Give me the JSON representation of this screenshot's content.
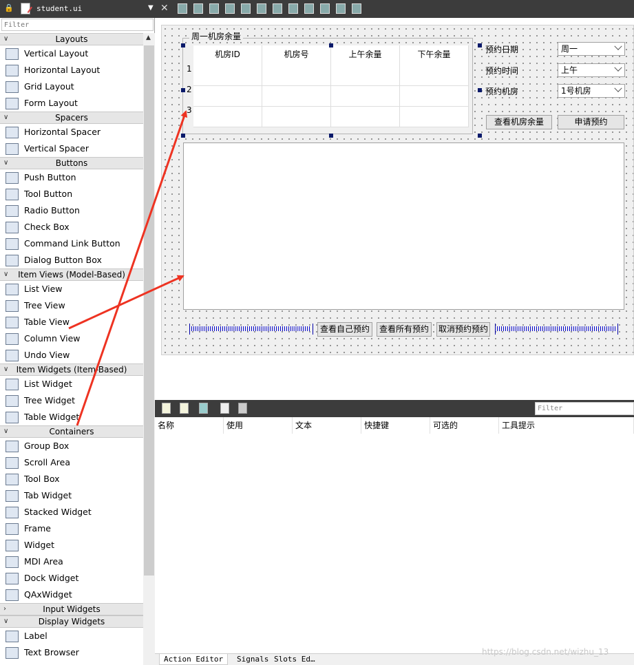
{
  "file_tab": {
    "name": "student.ui"
  },
  "widget_box": {
    "filter_placeholder": "Filter",
    "categories": [
      {
        "label": "Layouts",
        "expanded": true,
        "items": [
          {
            "label": "Vertical Layout",
            "icon": "vertical-layout-icon"
          },
          {
            "label": "Horizontal Layout",
            "icon": "horizontal-layout-icon"
          },
          {
            "label": "Grid Layout",
            "icon": "grid-layout-icon"
          },
          {
            "label": "Form Layout",
            "icon": "form-layout-icon"
          }
        ]
      },
      {
        "label": "Spacers",
        "expanded": true,
        "items": [
          {
            "label": "Horizontal Spacer",
            "icon": "horizontal-spacer-icon"
          },
          {
            "label": "Vertical Spacer",
            "icon": "vertical-spacer-icon"
          }
        ]
      },
      {
        "label": "Buttons",
        "expanded": true,
        "items": [
          {
            "label": "Push Button",
            "icon": "push-button-icon"
          },
          {
            "label": "Tool Button",
            "icon": "tool-button-icon"
          },
          {
            "label": "Radio Button",
            "icon": "radio-button-icon"
          },
          {
            "label": "Check Box",
            "icon": "check-box-icon"
          },
          {
            "label": "Command Link Button",
            "icon": "command-link-icon"
          },
          {
            "label": "Dialog Button Box",
            "icon": "dialog-button-box-icon"
          }
        ]
      },
      {
        "label": "Item Views (Model-Based)",
        "expanded": true,
        "items": [
          {
            "label": "List View",
            "icon": "list-view-icon"
          },
          {
            "label": "Tree View",
            "icon": "tree-view-icon"
          },
          {
            "label": "Table View",
            "icon": "table-view-icon"
          },
          {
            "label": "Column View",
            "icon": "column-view-icon"
          },
          {
            "label": "Undo View",
            "icon": "undo-view-icon"
          }
        ]
      },
      {
        "label": "Item Widgets (Item-Based)",
        "expanded": true,
        "items": [
          {
            "label": "List Widget",
            "icon": "list-widget-icon"
          },
          {
            "label": "Tree Widget",
            "icon": "tree-widget-icon"
          },
          {
            "label": "Table Widget",
            "icon": "table-widget-icon"
          }
        ]
      },
      {
        "label": "Containers",
        "expanded": true,
        "items": [
          {
            "label": "Group Box",
            "icon": "group-box-icon"
          },
          {
            "label": "Scroll Area",
            "icon": "scroll-area-icon"
          },
          {
            "label": "Tool Box",
            "icon": "tool-box-icon"
          },
          {
            "label": "Tab Widget",
            "icon": "tab-widget-icon"
          },
          {
            "label": "Stacked Widget",
            "icon": "stacked-widget-icon"
          },
          {
            "label": "Frame",
            "icon": "frame-icon"
          },
          {
            "label": "Widget",
            "icon": "widget-icon"
          },
          {
            "label": "MDI Area",
            "icon": "mdi-area-icon"
          },
          {
            "label": "Dock Widget",
            "icon": "dock-widget-icon"
          },
          {
            "label": "QAxWidget",
            "icon": "qaxwidget-icon"
          }
        ]
      },
      {
        "label": "Input Widgets",
        "expanded": false,
        "items": []
      },
      {
        "label": "Display Widgets",
        "expanded": true,
        "items": [
          {
            "label": "Label",
            "icon": "label-icon"
          },
          {
            "label": "Text Browser",
            "icon": "text-browser-icon"
          }
        ]
      }
    ]
  },
  "form": {
    "group_title": "周一机房余量",
    "table": {
      "headers": [
        "机房ID",
        "机房号",
        "上午余量",
        "下午余量"
      ],
      "row_numbers": [
        "1",
        "2",
        "3"
      ]
    },
    "labels": {
      "date": "预约日期",
      "time": "预约时间",
      "room": "预约机房"
    },
    "combos": {
      "date": "周一",
      "time": "上午",
      "room": "1号机房"
    },
    "buttons": {
      "check_remaining": "查看机房余量",
      "apply": "申请预约",
      "view_own": "查看自己预约",
      "view_all": "查看所有预约",
      "cancel": "取消预约预约"
    }
  },
  "action_editor": {
    "filter_placeholder": "Filter",
    "columns": [
      "名称",
      "使用",
      "文本",
      "快捷键",
      "可选的",
      "工具提示"
    ],
    "tabs": [
      "Action Editor",
      "Signals",
      "Slots Ed…"
    ]
  },
  "watermark": "https://blog.csdn.net/wizhu_13",
  "colors": {
    "toolbar_bg": "#3c3c3c",
    "handle": "#0a1a6a",
    "arrow": "#ee3322",
    "spacer": "#0000cc"
  }
}
